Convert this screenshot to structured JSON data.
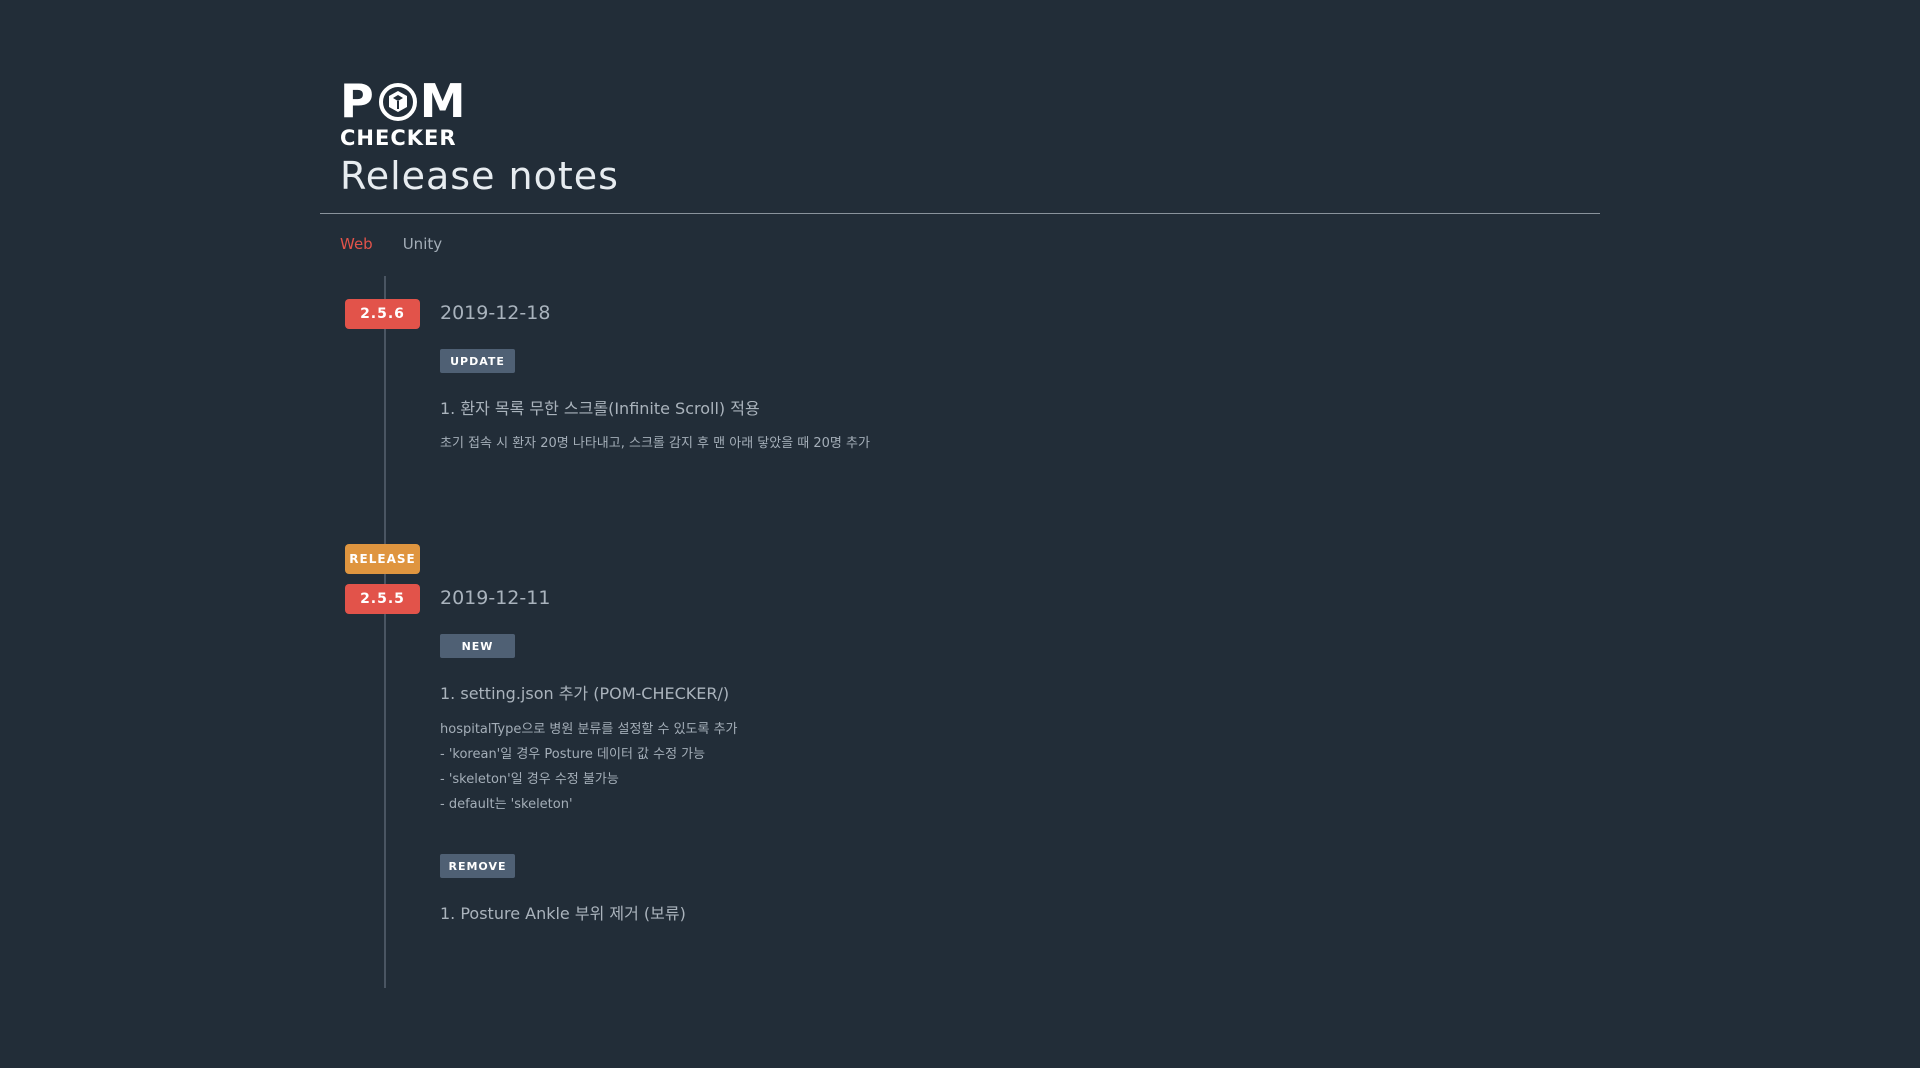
{
  "logo": {
    "top_left": "P",
    "top_right": "M",
    "bottom": "CHECKER"
  },
  "page": {
    "title": "Release notes"
  },
  "tabs": [
    {
      "label": "Web",
      "active": true
    },
    {
      "label": "Unity",
      "active": false
    }
  ],
  "releases": [
    {
      "version": "2.5.6",
      "date": "2019-12-18",
      "sections": [
        {
          "tag": "UPDATE",
          "title": "1. 환자 목록 무한 스크롤(Infinite Scroll) 적용",
          "lines": [
            "초기 접속 시 환자 20명 나타내고, 스크롤 감지 후 맨 아래 닿았을 때 20명 추가"
          ]
        }
      ]
    },
    {
      "release_badge": "RELEASE",
      "version": "2.5.5",
      "date": "2019-12-11",
      "sections": [
        {
          "tag": "NEW",
          "title": "1. setting.json 추가 (POM-CHECKER/)",
          "lines": [
            "hospitalType으로 병원 분류를 설정할 수 있도록 추가",
            "- 'korean'일 경우 Posture 데이터 값 수정 가능",
            "- 'skeleton'일 경우 수정 불가능",
            "- default는 'skeleton'"
          ]
        },
        {
          "tag": "REMOVE",
          "title": "1. Posture Ankle 부위 제거 (보류)",
          "lines": []
        }
      ]
    }
  ],
  "colors": {
    "background": "#222d38",
    "accent": "#e2534a",
    "release": "#df953f",
    "tag": "#4f6074"
  }
}
